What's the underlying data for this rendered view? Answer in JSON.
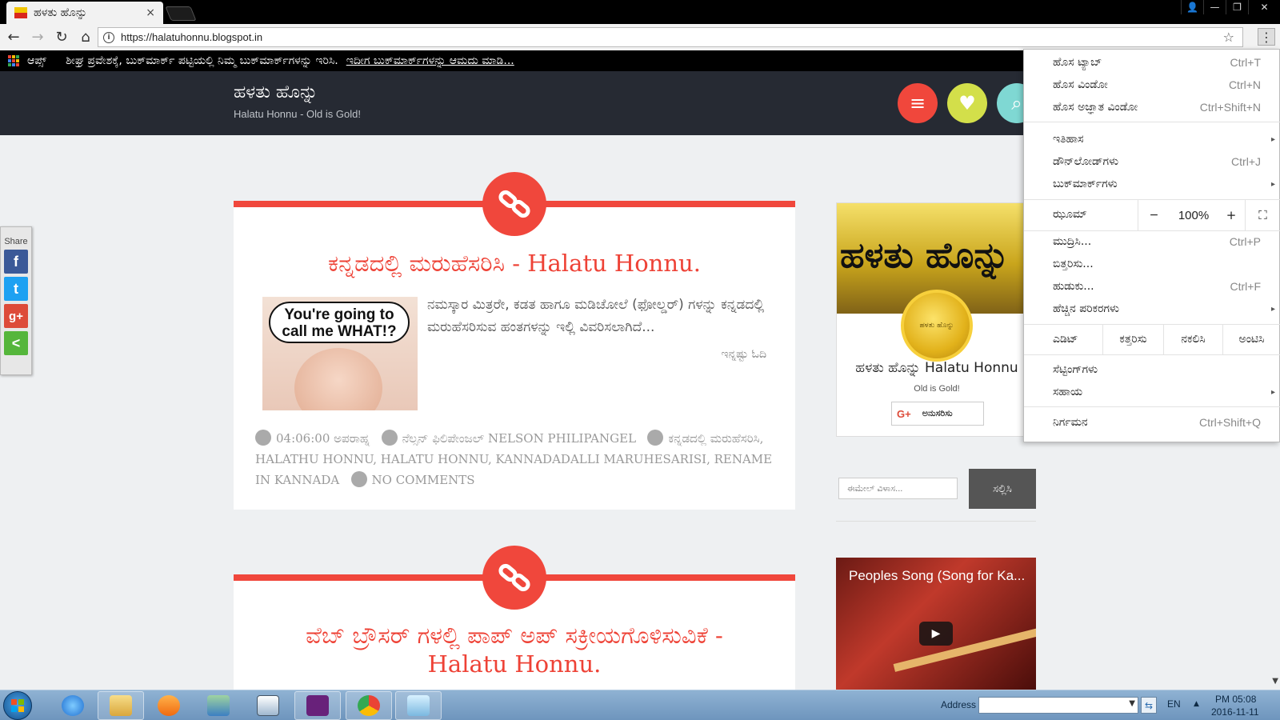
{
  "browser": {
    "tab_title": "ಹಳತು ಹೊನ್ನು",
    "tab_close": "×",
    "url": "https://halatuhonnu.blogspot.in",
    "window_controls": {
      "user": "👤",
      "minimize": "—",
      "restore": "❐",
      "close": "✕"
    },
    "nav": {
      "back": "←",
      "forward": "→",
      "reload": "↻",
      "home": "⌂"
    },
    "bookmarks_bar": {
      "apps_label": "ಆಪ್ಸ್",
      "hint": "ಶೀಘ್ರ ಪ್ರವೇಶಕ್ಕೆ, ಬುಕ್‌ಮಾರ್ಕ್ ಪಟ್ಟಿಯಲ್ಲಿ ನಿಮ್ಮ ಬುಕ್‌ಮಾರ್ಕ್‌ಗಳನ್ನು ಇರಿಸಿ.",
      "import_link": "ಇದೀಗ ಬುಕ್‌ಮಾರ್ಕ್‌ಗಳನ್ನು ಆಮದು ಮಾಡಿ..."
    }
  },
  "site": {
    "title": "ಹಳತು ಹೊನ್ನು",
    "tagline": "Halatu Honnu - Old is Gold!",
    "header_buttons": {
      "menu": "≡",
      "favorite": "♥",
      "search": "⌕"
    }
  },
  "share": {
    "label": "Share",
    "facebook": "f",
    "twitter": "t",
    "gplus": "g+",
    "more": "<"
  },
  "posts": [
    {
      "title": "ಕನ್ನಡದಲ್ಲಿ ಮರುಹೆಸರಿಸಿ - Halatu Honnu.",
      "thumb_caption": "You're going to call me WHAT!?",
      "excerpt": "ನಮಸ್ಕಾರ ಮಿತ್ರರೇ, ಕಡತ ಹಾಗೂ ಮಡಿಚೋಲೆ (ಫೋಲ್ಡರ್) ಗಳನ್ನು ಕನ್ನಡದಲ್ಲಿ ಮರುಹೆಸರಿಸುವ ಹಂತಗಳನ್ನು ಇಲ್ಲಿ ವಿವರಿಸಲಾಗಿದೆ...",
      "read_more": "ಇನ್ನಷ್ಟು ಓದಿ",
      "time": "04:06:00 ಅಪರಾಹ್ನ",
      "author": "ನೆಲ್ಸನ್ ಫಿಲಿಪೇಂಜಲ್ NELSON PHILIPANGEL",
      "labels": "ಕನ್ನಡದಲ್ಲಿ ಮರುಹೆಸರಿಸಿ, HALATHU HONNU, HALATU HONNU, KANNADADALLI MARUHESARISI, RENAME IN KANNADA",
      "comments": "NO COMMENTS"
    },
    {
      "title": "ವೆಬ್ ಬ್ರೌಸರ್ ಗಳಲ್ಲಿ ಪಾಪ್ ಅಪ್ ಸಕ್ರೀಯಗೊಳಿಸುವಿಕೆ - Halatu Honnu."
    }
  ],
  "sidebar": {
    "banner_text": "ಹಳತು ಹೊನ್ನು",
    "coin_text": "ಹಳತು ಹೊನ್ನು",
    "profile_name": "ಹಳತು ಹೊನ್ನು Halatu Honnu",
    "profile_sub": "Old is Gold!",
    "follow_icon": "G+",
    "follow_label": "ಅನುಸರಿಸು",
    "email_placeholder": "ಈಮೇಲ್ ವಿಳಾಸ...",
    "subscribe_label": "ಸಲ್ಲಿಸಿ",
    "video_title": "Peoples Song (Song for Ka...",
    "play": "▶"
  },
  "menu": {
    "new_tab": {
      "label": "ಹೊಸ ಟ್ಯಾಬ್",
      "shortcut": "Ctrl+T"
    },
    "new_window": {
      "label": "ಹೊಸ ವಿಂಡೋ",
      "shortcut": "Ctrl+N"
    },
    "incognito": {
      "label": "ಹೊಸ ಅಜ್ಞಾತ ವಿಂಡೋ",
      "shortcut": "Ctrl+Shift+N"
    },
    "history": {
      "label": "ಇತಿಹಾಸ"
    },
    "downloads": {
      "label": "ಡೌನ್‌ಲೋಡ್‌ಗಳು",
      "shortcut": "Ctrl+J"
    },
    "bookmarks": {
      "label": "ಬುಕ್‌ಮಾರ್ಕ್‌ಗಳು"
    },
    "zoom": {
      "label": "ಝೂಮ್",
      "minus": "−",
      "value": "100%",
      "plus": "+",
      "fullscreen": "⛶"
    },
    "print": {
      "label": "ಮುದ್ರಿಸಿ...",
      "shortcut": "Ctrl+P"
    },
    "cast": {
      "label": "ಬಿತ್ತರಿಸು..."
    },
    "find": {
      "label": "ಹುಡುಕು...",
      "shortcut": "Ctrl+F"
    },
    "more_tools": {
      "label": "ಹೆಚ್ಚಿನ ಪರಿಕರಗಳು"
    },
    "edit": {
      "label": "ಎಡಿಟ್",
      "cut": "ಕತ್ತರಿಸು",
      "copy": "ನಕಲಿಸಿ",
      "paste": "ಅಂಟಿಸಿ"
    },
    "settings": {
      "label": "ಸೆಟ್ಟಿಂಗ್‌ಗಳು"
    },
    "help": {
      "label": "ಸಹಾಯ"
    },
    "exit": {
      "label": "ನಿರ್ಗಮನ",
      "shortcut": "Ctrl+Shift+Q"
    },
    "submenu_arrow": "▸"
  },
  "taskbar": {
    "address_label": "Address",
    "go": "⇆",
    "language": "EN",
    "tray_arrow": "▲",
    "time": "PM 05:08",
    "date": "2016-11-11"
  },
  "colors": {
    "accent": "#f0473c",
    "header_bg": "#262a33",
    "favorite_btn": "#d3df4a",
    "search_btn": "#7fd8d3"
  }
}
